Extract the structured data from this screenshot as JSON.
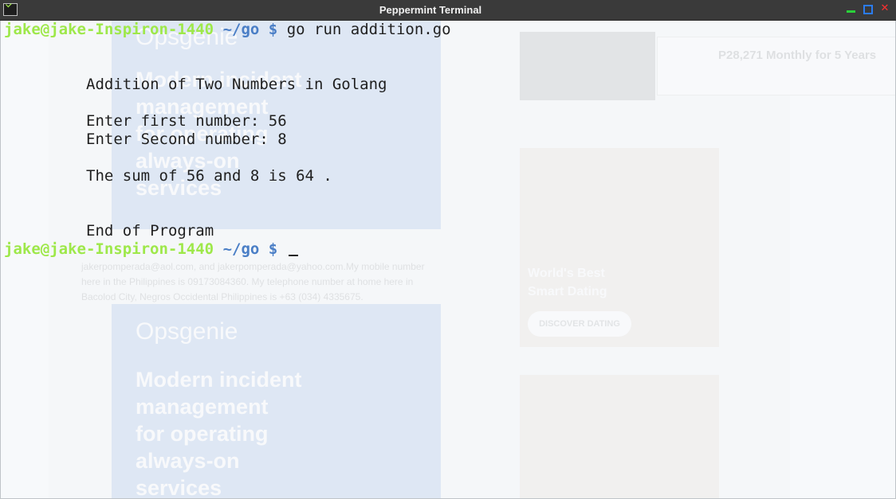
{
  "window": {
    "title": "Peppermint Terminal",
    "close_glyph": "✕",
    "icons": {
      "app": "terminal-icon",
      "minimize": "minimize-icon",
      "maximize": "maximize-icon",
      "close": "close-icon"
    }
  },
  "terminal": {
    "prompt": {
      "user": "jake@jake-Inspiron-1440",
      "path": "~/go",
      "symbol": "$"
    },
    "command": "go run addition.go",
    "output": [
      "Addition of Two Numbers in Golang",
      "Enter first number: 56",
      "Enter Second number: 8",
      "The sum of 56 and 8 is 64 .",
      "End of Program"
    ]
  },
  "background": {
    "ad_blue": {
      "brand": "Opsgenie",
      "lines": [
        "Modern incident",
        "management",
        "for operating",
        "always-on",
        "services"
      ]
    },
    "ad_photo": {
      "lines": [
        "World's Best",
        "Smart Dating"
      ],
      "cta": "DISCOVER DATING"
    },
    "mazda": {
      "title": "P28,271 Monthly for 5 Years"
    },
    "page_text": [
      "jakerpomperada@aol.com, and jakerpomperada@yahoo.com.My mobile number",
      "here in the Philippines is 09173084360. My telephone number at home here in",
      "Bacolod City, Negros Occidental Philippines is +63 (034) 4335675."
    ]
  },
  "colors": {
    "prompt_user": "#9ee84a",
    "prompt_path": "#4a7ec6",
    "text": "#1f1f1f",
    "titlebar": "#3a3a3a"
  }
}
